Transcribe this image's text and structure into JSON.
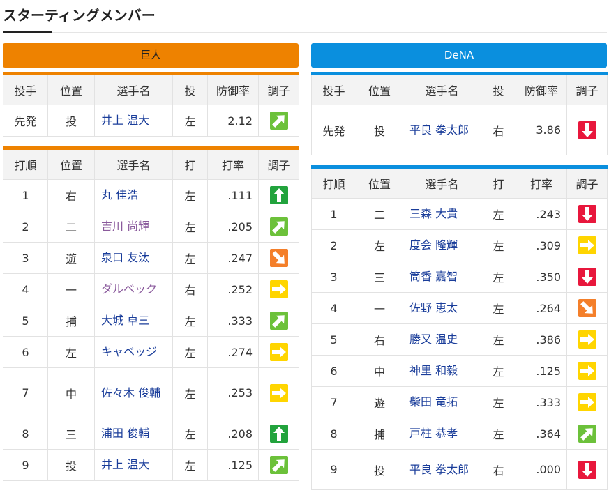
{
  "page": {
    "title": "スターティングメンバー"
  },
  "colors": {
    "home": "#ee8200",
    "away": "#0a8fde",
    "link": "#1a3d9a",
    "visited": "#8a5a9c"
  },
  "condition_icons": {
    "up": "arrow-up-icon",
    "upright": "arrow-up-right-icon",
    "right": "arrow-right-icon",
    "downright": "arrow-down-right-icon",
    "down": "arrow-down-icon"
  },
  "home": {
    "team_name": "巨人",
    "pitcher_headers": [
      "投手",
      "位置",
      "選手名",
      "投",
      "防御率",
      "調子"
    ],
    "pitcher": {
      "role": "先発",
      "pos": "投",
      "name": "井上 温大",
      "hand": "左",
      "era": "2.12",
      "cond": "upright"
    },
    "batter_headers": [
      "打順",
      "位置",
      "選手名",
      "打",
      "打率",
      "調子"
    ],
    "batters": [
      {
        "order": "1",
        "pos": "右",
        "name": "丸 佳浩",
        "hand": "左",
        "avg": ".111",
        "cond": "up",
        "visited": false
      },
      {
        "order": "2",
        "pos": "二",
        "name": "吉川 尚輝",
        "hand": "左",
        "avg": ".205",
        "cond": "upright",
        "visited": true
      },
      {
        "order": "3",
        "pos": "遊",
        "name": "泉口 友汰",
        "hand": "左",
        "avg": ".247",
        "cond": "downright",
        "visited": false
      },
      {
        "order": "4",
        "pos": "一",
        "name": "ダルベック",
        "hand": "右",
        "avg": ".252",
        "cond": "right",
        "visited": true
      },
      {
        "order": "5",
        "pos": "捕",
        "name": "大城 卓三",
        "hand": "左",
        "avg": ".333",
        "cond": "upright",
        "visited": false
      },
      {
        "order": "6",
        "pos": "左",
        "name": "キャベッジ",
        "hand": "左",
        "avg": ".274",
        "cond": "right",
        "visited": false
      },
      {
        "order": "7",
        "pos": "中",
        "name": "佐々木 俊輔",
        "hand": "左",
        "avg": ".253",
        "cond": "right",
        "visited": false
      },
      {
        "order": "8",
        "pos": "三",
        "name": "浦田 俊輔",
        "hand": "左",
        "avg": ".208",
        "cond": "up",
        "visited": false
      },
      {
        "order": "9",
        "pos": "投",
        "name": "井上 温大",
        "hand": "左",
        "avg": ".125",
        "cond": "upright",
        "visited": false
      }
    ]
  },
  "away": {
    "team_name": "DeNA",
    "pitcher_headers": [
      "投手",
      "位置",
      "選手名",
      "投",
      "防御率",
      "調子"
    ],
    "pitcher": {
      "role": "先発",
      "pos": "投",
      "name": "平良 拳太郎",
      "hand": "右",
      "era": "3.86",
      "cond": "down"
    },
    "batter_headers": [
      "打順",
      "位置",
      "選手名",
      "打",
      "打率",
      "調子"
    ],
    "batters": [
      {
        "order": "1",
        "pos": "二",
        "name": "三森 大貴",
        "hand": "左",
        "avg": ".243",
        "cond": "down",
        "visited": false
      },
      {
        "order": "2",
        "pos": "左",
        "name": "度会 隆輝",
        "hand": "左",
        "avg": ".309",
        "cond": "right",
        "visited": false
      },
      {
        "order": "3",
        "pos": "三",
        "name": "筒香 嘉智",
        "hand": "左",
        "avg": ".350",
        "cond": "down",
        "visited": false
      },
      {
        "order": "4",
        "pos": "一",
        "name": "佐野 恵太",
        "hand": "左",
        "avg": ".264",
        "cond": "downright",
        "visited": false
      },
      {
        "order": "5",
        "pos": "右",
        "name": "勝又 温史",
        "hand": "左",
        "avg": ".386",
        "cond": "right",
        "visited": false
      },
      {
        "order": "6",
        "pos": "中",
        "name": "神里 和毅",
        "hand": "左",
        "avg": ".125",
        "cond": "right",
        "visited": false
      },
      {
        "order": "7",
        "pos": "遊",
        "name": "柴田 竜拓",
        "hand": "左",
        "avg": ".333",
        "cond": "right",
        "visited": false
      },
      {
        "order": "8",
        "pos": "捕",
        "name": "戸柱 恭孝",
        "hand": "左",
        "avg": ".364",
        "cond": "upright",
        "visited": false
      },
      {
        "order": "9",
        "pos": "投",
        "name": "平良 拳太郎",
        "hand": "右",
        "avg": ".000",
        "cond": "down",
        "visited": false
      }
    ]
  }
}
